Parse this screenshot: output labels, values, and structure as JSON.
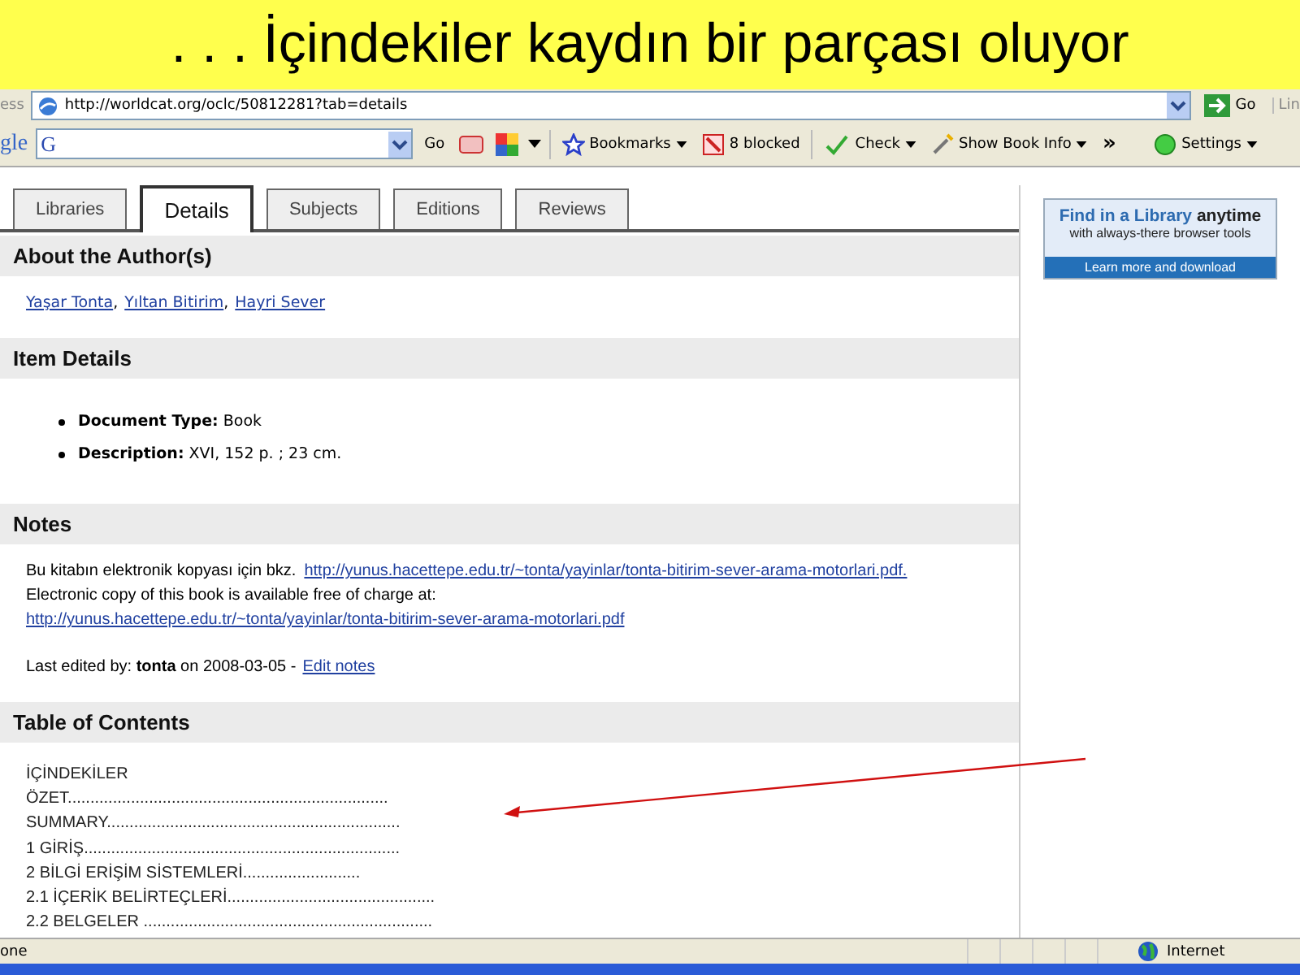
{
  "slide_title": ". . . İçindekiler kaydın bir parçası oluyor",
  "address_bar": {
    "label": "ess",
    "url": "http://worldcat.org/oclc/50812281?tab=details",
    "go": "Go",
    "links_label": "Lin"
  },
  "google_toolbar": {
    "logo": "gle",
    "engine_icon": "G",
    "search_go": "Go",
    "bookmarks": "Bookmarks",
    "blocked": "8 blocked",
    "check": "Check",
    "show_book_info": "Show Book Info",
    "more": "»",
    "settings": "Settings"
  },
  "tabs": [
    {
      "label": "Libraries",
      "selected": false
    },
    {
      "label": "Details",
      "selected": true
    },
    {
      "label": "Subjects",
      "selected": false
    },
    {
      "label": "Editions",
      "selected": false
    },
    {
      "label": "Reviews",
      "selected": false
    }
  ],
  "authors_section": {
    "heading": "About the Author(s)",
    "authors": [
      {
        "name": "Yaşar Tonta",
        "suffix": ","
      },
      {
        "name": "Yıltan Bitirim",
        "suffix": ","
      },
      {
        "name": "Hayri Sever"
      }
    ]
  },
  "item_details": {
    "heading": "Item Details",
    "items": [
      "**Document Type:** Book",
      "**Description:** XVI, 152 p. ; 23 cm."
    ]
  },
  "notes": {
    "heading": "Notes",
    "lines": [
      [
        {
          "kind": "text",
          "text": "Bu kitabın elektronik kopyası için bkz."
        },
        {
          "kind": "link",
          "text": "http://yunus.hacettepe.edu.tr/~tonta/yayinlar/tonta-bitirim-sever-arama-motorlari.pdf."
        }
      ],
      [
        {
          "kind": "text",
          "text": "Electronic copy of this book is available free of charge at:"
        },
        {
          "kind": "link",
          "text": "http://yunus.hacettepe.edu.tr/~tonta/yayinlar/tonta-bitirim-sever-arama-motorlari.pdf"
        }
      ]
    ],
    "edited": "Last edited by: **tonta** on 2008-03-05 -",
    "edit_link": "Edit notes"
  },
  "contents": {
    "heading": "Table of Contents",
    "entries": [
      "İÇİNDEKİLER",
      "ÖZET.......................................................................",
      "SUMMARY.................................................................",
      "1 GİRİŞ......................................................................",
      "2 BİLGİ ERİŞİM SİSTEMLERİ..........................",
      "2.1 İÇERİK BELİRTEÇLERİ..............................................",
      "2.2 BELGELER ................................................................"
    ]
  },
  "promo": {
    "highlight": "Find in a Library",
    "title_rest": "anytime",
    "subtitle": "with always-there browser tools",
    "link": "Learn more and download"
  },
  "status_bar": {
    "text": "one",
    "zone": "Internet"
  }
}
